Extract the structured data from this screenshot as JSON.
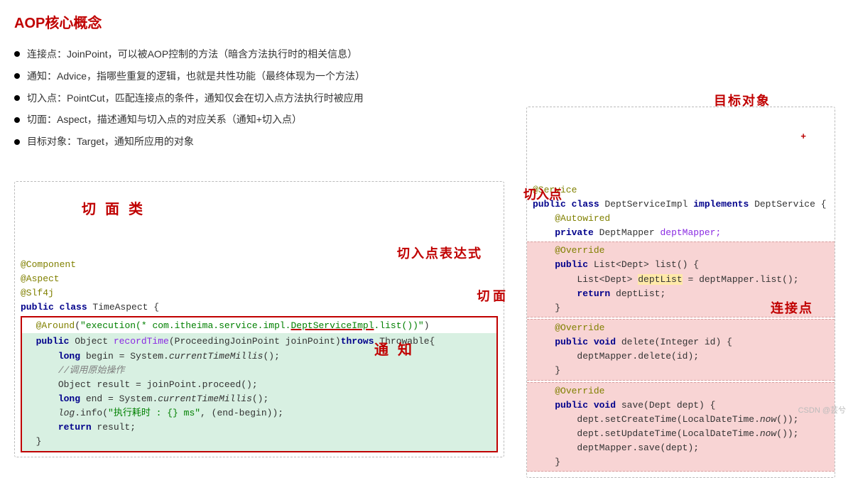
{
  "title": "AOP核心概念",
  "bullets": [
    "连接点：JoinPoint，可以被AOP控制的方法（暗含方法执行时的相关信息）",
    "通知：Advice，指哪些重复的逻辑，也就是共性功能（最终体现为一个方法）",
    "切入点：PointCut，匹配连接点的条件，通知仅会在切入点方法执行时被应用",
    "切面：Aspect，描述通知与切入点的对应关系（通知+切入点）",
    "目标对象：Target，通知所应用的对象"
  ],
  "hand": {
    "aspect": "切 面 类",
    "pointcut_expr": "切入点表达式",
    "advice": "通 知",
    "qiemian": "切 面",
    "target": "目标对象",
    "pointcut": "切入点",
    "joinpoint": "连接点"
  },
  "left": {
    "comp": "@Component",
    "asp": "@Aspect",
    "slf": "@Slf4j",
    "pub": "public ",
    "cls": "class ",
    "name": "TimeAspect {",
    "around_a": "@Around",
    "around_b": "(",
    "around_c": "\"execution(* com.itheima.service.impl.",
    "around_d": "DeptServiceImpl",
    "around_e": ".list())\"",
    "around_f": ")",
    "m_pub": "public ",
    "m_obj": "Object ",
    "m_name": "recordTime",
    "m_args": "(ProceedingJoinPoint joinPoint)",
    "m_throws": "throws ",
    "m_thr": "Throwable{",
    "l_long1": "long ",
    "l_begin": "begin = System.",
    "l_ctm1": "currentTimeMillis",
    "l_end1": "();",
    "cmt": "//调用原始操作",
    "r_line": "Object result = joinPoint.proceed();",
    "l_long2": "long ",
    "l_end2a": "end = System.",
    "l_ctm2": "currentTimeMillis",
    "l_end2b": "();",
    "log_a": "log",
    "log_b": ".info(",
    "log_c": "\"执行耗时 : {} ms\"",
    "log_d": ", (end-begin));",
    "ret": "return ",
    "ret_v": "result;",
    "brace": "}"
  },
  "right": {
    "svc": "@Service",
    "pub": "public ",
    "cls": "class ",
    "name": "DeptServiceImpl ",
    "impl": "implements ",
    "iface": "DeptService {",
    "aw": "@Autowired",
    "priv": "private ",
    "dmtype": "DeptMapper ",
    "dm": "deptMapper;",
    "ov": "@Override",
    "list_a": "public ",
    "list_b": "List<Dept> list() {",
    "list_c1": "List<Dept> ",
    "list_c2": "deptList",
    "list_c3": " = deptMapper.list();",
    "list_d": "return ",
    "list_e": "deptList;",
    "brace": "}",
    "del_a": "public ",
    "del_b": "void ",
    "del_c": "delete(Integer id) {",
    "del_d": "deptMapper.delete(id);",
    "save_a": "public ",
    "save_b": "void ",
    "save_c": "save(Dept dept) {",
    "save_d1": "dept.setCreateTime(LocalDateTime.",
    "save_d2": "now",
    "save_d3": "());",
    "save_e1": "dept.setUpdateTime(LocalDateTime.",
    "save_e2": "now",
    "save_e3": "());",
    "save_f": "deptMapper.save(dept);"
  },
  "watermark": "CSDN @芸兮",
  "plus": "+"
}
